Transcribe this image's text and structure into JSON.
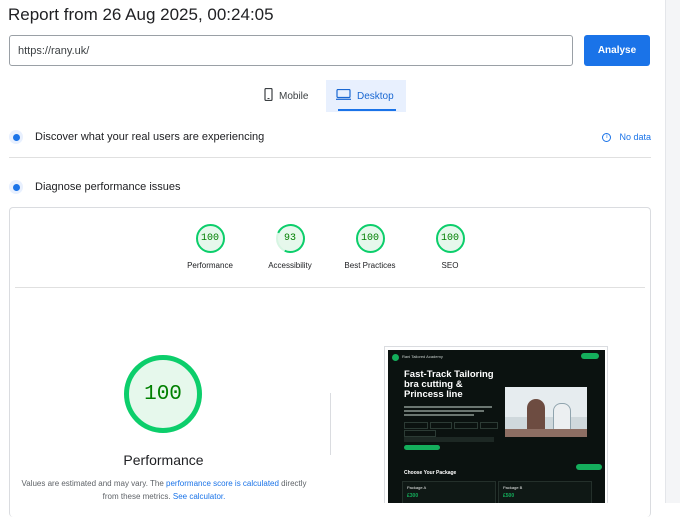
{
  "report": {
    "title": "Report from 26 Aug 2025, 00:24:05"
  },
  "url_bar": {
    "value": "https://rany.uk/",
    "analyse_label": "Analyse"
  },
  "device_tabs": [
    {
      "label": "Mobile",
      "icon": "phone-icon",
      "selected": false
    },
    {
      "label": "Desktop",
      "icon": "monitor-icon",
      "selected": true
    }
  ],
  "field_data": {
    "text": "Discover what your real users are experiencing",
    "status": "No data"
  },
  "diagnose": {
    "text": "Diagnose performance issues"
  },
  "scores": [
    {
      "label": "Performance",
      "value": "100"
    },
    {
      "label": "Accessibility",
      "value": "93"
    },
    {
      "label": "Best Practices",
      "value": "100"
    },
    {
      "label": "SEO",
      "value": "100"
    }
  ],
  "performance_panel": {
    "score": "100",
    "title": "Performance",
    "note_part1": "Values are estimated and may vary. The ",
    "note_link1": "performance score is calculated",
    "note_part2": " directly from these metrics. ",
    "note_link2": "See calculator."
  },
  "thumbnail": {
    "brand": "Rani Tailored Academy",
    "headline": "Fast-Track Tailoring bra cutting & Princess line",
    "section": "Choose Your Package",
    "card1": "Package A",
    "card1_price": "£300",
    "card2": "Package B",
    "card2_price": "£500"
  },
  "colors": {
    "accent": "#1a73e8",
    "pass": "#0cce6b",
    "pass_text": "#008000"
  }
}
